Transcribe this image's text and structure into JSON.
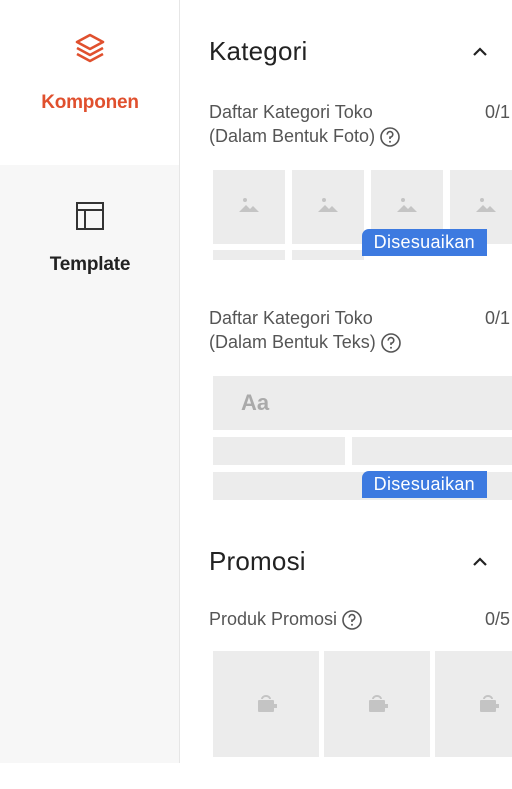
{
  "sidebar": {
    "items": [
      {
        "label": "Komponen",
        "icon": "layers-icon",
        "active": true
      },
      {
        "label": "Template",
        "icon": "template-layout-icon",
        "active": false
      }
    ]
  },
  "sections": [
    {
      "title": "Kategori",
      "expanded": true,
      "items": [
        {
          "label_line1": "Daftar Kategori Toko",
          "label_line2": "(Dalam Bentuk Foto)",
          "count": "0/1",
          "badge": "Disesuaikan"
        },
        {
          "label_line1": "Daftar Kategori Toko",
          "label_line2": "(Dalam Bentuk Teks)",
          "count": "0/1",
          "badge": "Disesuaikan",
          "sample_text": "Aa"
        }
      ]
    },
    {
      "title": "Promosi",
      "expanded": true,
      "items": [
        {
          "label_line1": "Produk Promosi",
          "count": "0/5"
        }
      ]
    }
  ],
  "colors": {
    "accent": "#e0502e",
    "badge": "#3d7ae0",
    "placeholder": "#ececec",
    "rail_background": "#f7f7f7"
  }
}
